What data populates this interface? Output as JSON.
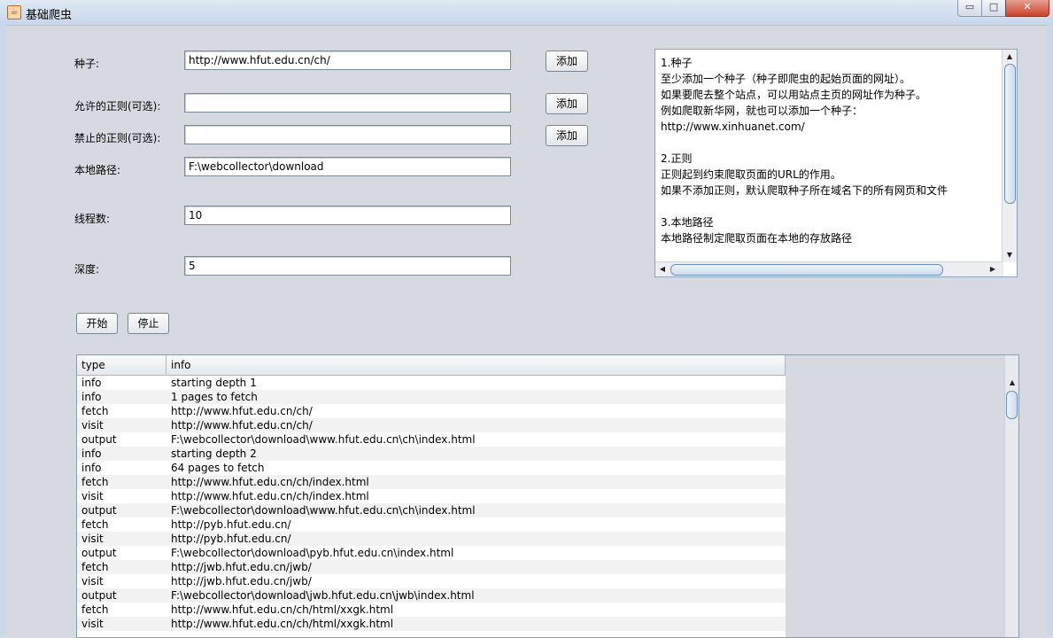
{
  "window": {
    "title": "基础爬虫",
    "min_glyph": "▭",
    "max_glyph": "□",
    "close_glyph": "✕"
  },
  "form": {
    "seed_label": "种子:",
    "seed_value": "http://www.hfut.edu.cn/ch/",
    "allow_regex_label": "允许的正则(可选):",
    "allow_regex_value": "",
    "forbid_regex_label": "禁止的正则(可选):",
    "forbid_regex_value": "",
    "path_label": "本地路径:",
    "path_value": "F:\\webcollector\\download",
    "threads_label": "线程数:",
    "threads_value": "10",
    "depth_label": "深度:",
    "depth_value": "5",
    "add_label": "添加",
    "start_label": "开始",
    "stop_label": "停止"
  },
  "help": {
    "lines": [
      "1.种子",
      "至少添加一个种子（种子即爬虫的起始页面的网址）。",
      "如果要爬去整个站点，可以用站点主页的网址作为种子。",
      "例如爬取新华网，就也可以添加一个种子：",
      "   http://www.xinhuanet.com/",
      "",
      "2.正则",
      "正则起到约束爬取页面的URL的作用。",
      "如果不添加正则，默认爬取种子所在域名下的所有网页和文件",
      "",
      "3.本地路径",
      "本地路径制定爬取页面在本地的存放路径"
    ]
  },
  "log": {
    "columns": [
      "type",
      "info"
    ],
    "rows": [
      [
        "info",
        "starting depth 1"
      ],
      [
        "info",
        "1 pages to fetch"
      ],
      [
        "fetch",
        "http://www.hfut.edu.cn/ch/"
      ],
      [
        "visit",
        "http://www.hfut.edu.cn/ch/"
      ],
      [
        "output",
        "F:\\webcollector\\download\\www.hfut.edu.cn\\ch\\index.html"
      ],
      [
        "info",
        "starting depth 2"
      ],
      [
        "info",
        "64 pages to fetch"
      ],
      [
        "fetch",
        "http://www.hfut.edu.cn/ch/index.html"
      ],
      [
        "visit",
        "http://www.hfut.edu.cn/ch/index.html"
      ],
      [
        "output",
        "F:\\webcollector\\download\\www.hfut.edu.cn\\ch\\index.html"
      ],
      [
        "fetch",
        "http://pyb.hfut.edu.cn/"
      ],
      [
        "visit",
        "http://pyb.hfut.edu.cn/"
      ],
      [
        "output",
        "F:\\webcollector\\download\\pyb.hfut.edu.cn\\index.html"
      ],
      [
        "fetch",
        "http://jwb.hfut.edu.cn/jwb/"
      ],
      [
        "visit",
        "http://jwb.hfut.edu.cn/jwb/"
      ],
      [
        "output",
        "F:\\webcollector\\download\\jwb.hfut.edu.cn\\jwb\\index.html"
      ],
      [
        "fetch",
        "http://www.hfut.edu.cn/ch/html/xxgk.html"
      ],
      [
        "visit",
        "http://www.hfut.edu.cn/ch/html/xxgk.html"
      ]
    ]
  }
}
